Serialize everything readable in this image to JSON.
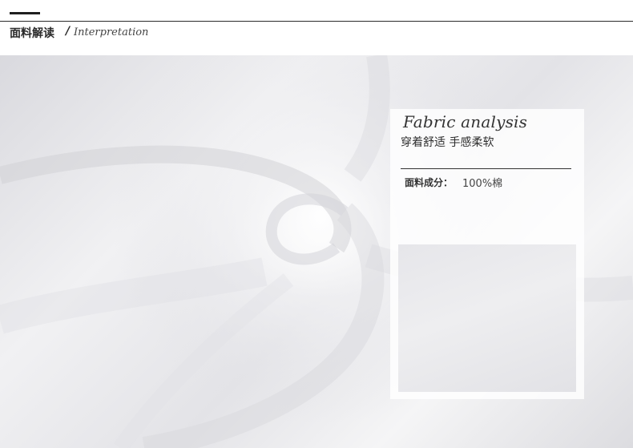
{
  "header": {
    "title_cn": "面料解读",
    "slash": "/",
    "title_en": "Interpretation"
  },
  "card": {
    "title": "Fabric analysis",
    "subtitle": "穿着舒适 手感柔软",
    "composition_label": "面料成分：",
    "composition_value": "100%棉"
  }
}
